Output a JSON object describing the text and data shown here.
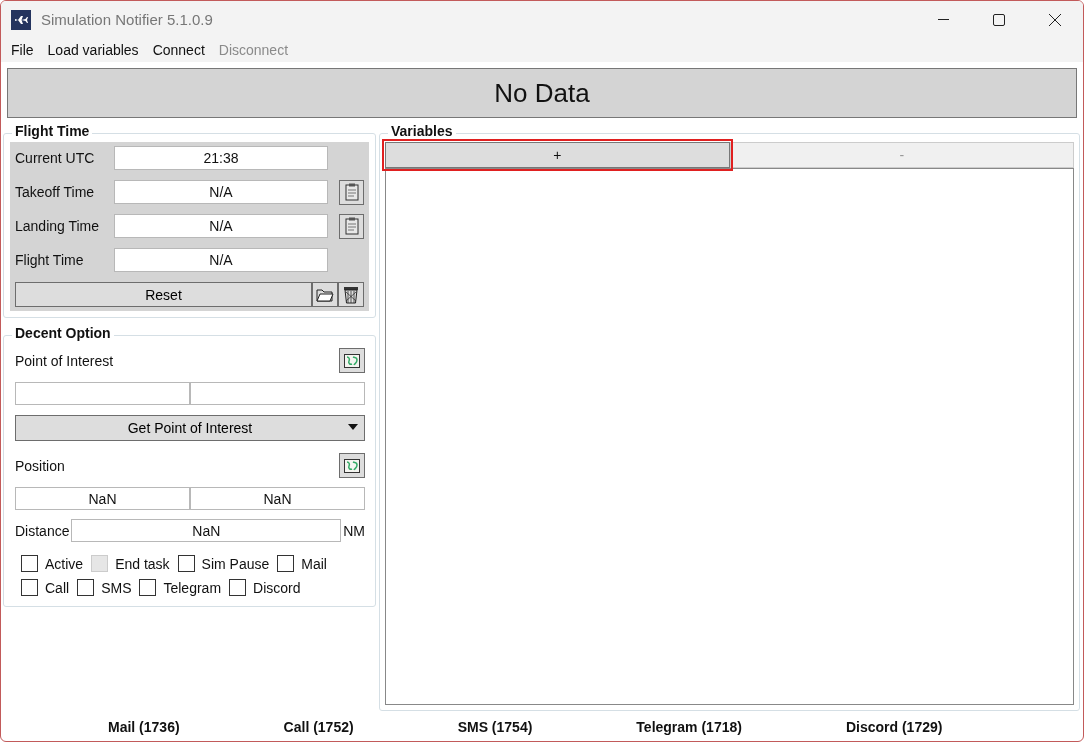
{
  "window": {
    "title": "Simulation Notifier 5.1.0.9"
  },
  "menu": [
    {
      "label": "File",
      "disabled": false
    },
    {
      "label": "Load variables",
      "disabled": false
    },
    {
      "label": "Connect",
      "disabled": false
    },
    {
      "label": "Disconnect",
      "disabled": true
    }
  ],
  "banner": "No Data",
  "flight_time": {
    "title": "Flight Time",
    "rows": [
      {
        "label": "Current UTC",
        "value": "21:38",
        "kind": "plain"
      },
      {
        "label": "Takeoff Time",
        "value": "N/A",
        "kind": "clipboard"
      },
      {
        "label": "Landing Time",
        "value": "N/A",
        "kind": "clipboard"
      },
      {
        "label": "Flight Time",
        "value": "N/A",
        "kind": "plain"
      }
    ],
    "reset": "Reset"
  },
  "decent_option": {
    "title": "Decent Option",
    "poi_label": "Point of Interest",
    "get_poi": "Get Point of Interest",
    "position_label": "Position",
    "position_values": [
      "NaN",
      "NaN"
    ],
    "distance": {
      "label": "Distance",
      "value": "NaN",
      "unit": "NM"
    },
    "checkboxes": [
      {
        "label": "Active",
        "checked": false,
        "disabled": false
      },
      {
        "label": "End task",
        "checked": false,
        "disabled": true
      },
      {
        "label": "Sim Pause",
        "checked": false,
        "disabled": false
      },
      {
        "label": "Mail",
        "checked": false,
        "disabled": false
      },
      {
        "label": "Call",
        "checked": false,
        "disabled": false
      },
      {
        "label": "SMS",
        "checked": false,
        "disabled": false
      },
      {
        "label": "Telegram",
        "checked": false,
        "disabled": false
      },
      {
        "label": "Discord",
        "checked": false,
        "disabled": false
      }
    ]
  },
  "variables": {
    "title": "Variables",
    "buttons": [
      {
        "label": "+",
        "focused": true,
        "disabled": false
      },
      {
        "label": "-",
        "focused": false,
        "disabled": true
      }
    ]
  },
  "status_bar": [
    "Mail (1736)",
    "Call (1752)",
    "SMS (1754)",
    "Telegram (1718)",
    "Discord (1729)"
  ]
}
